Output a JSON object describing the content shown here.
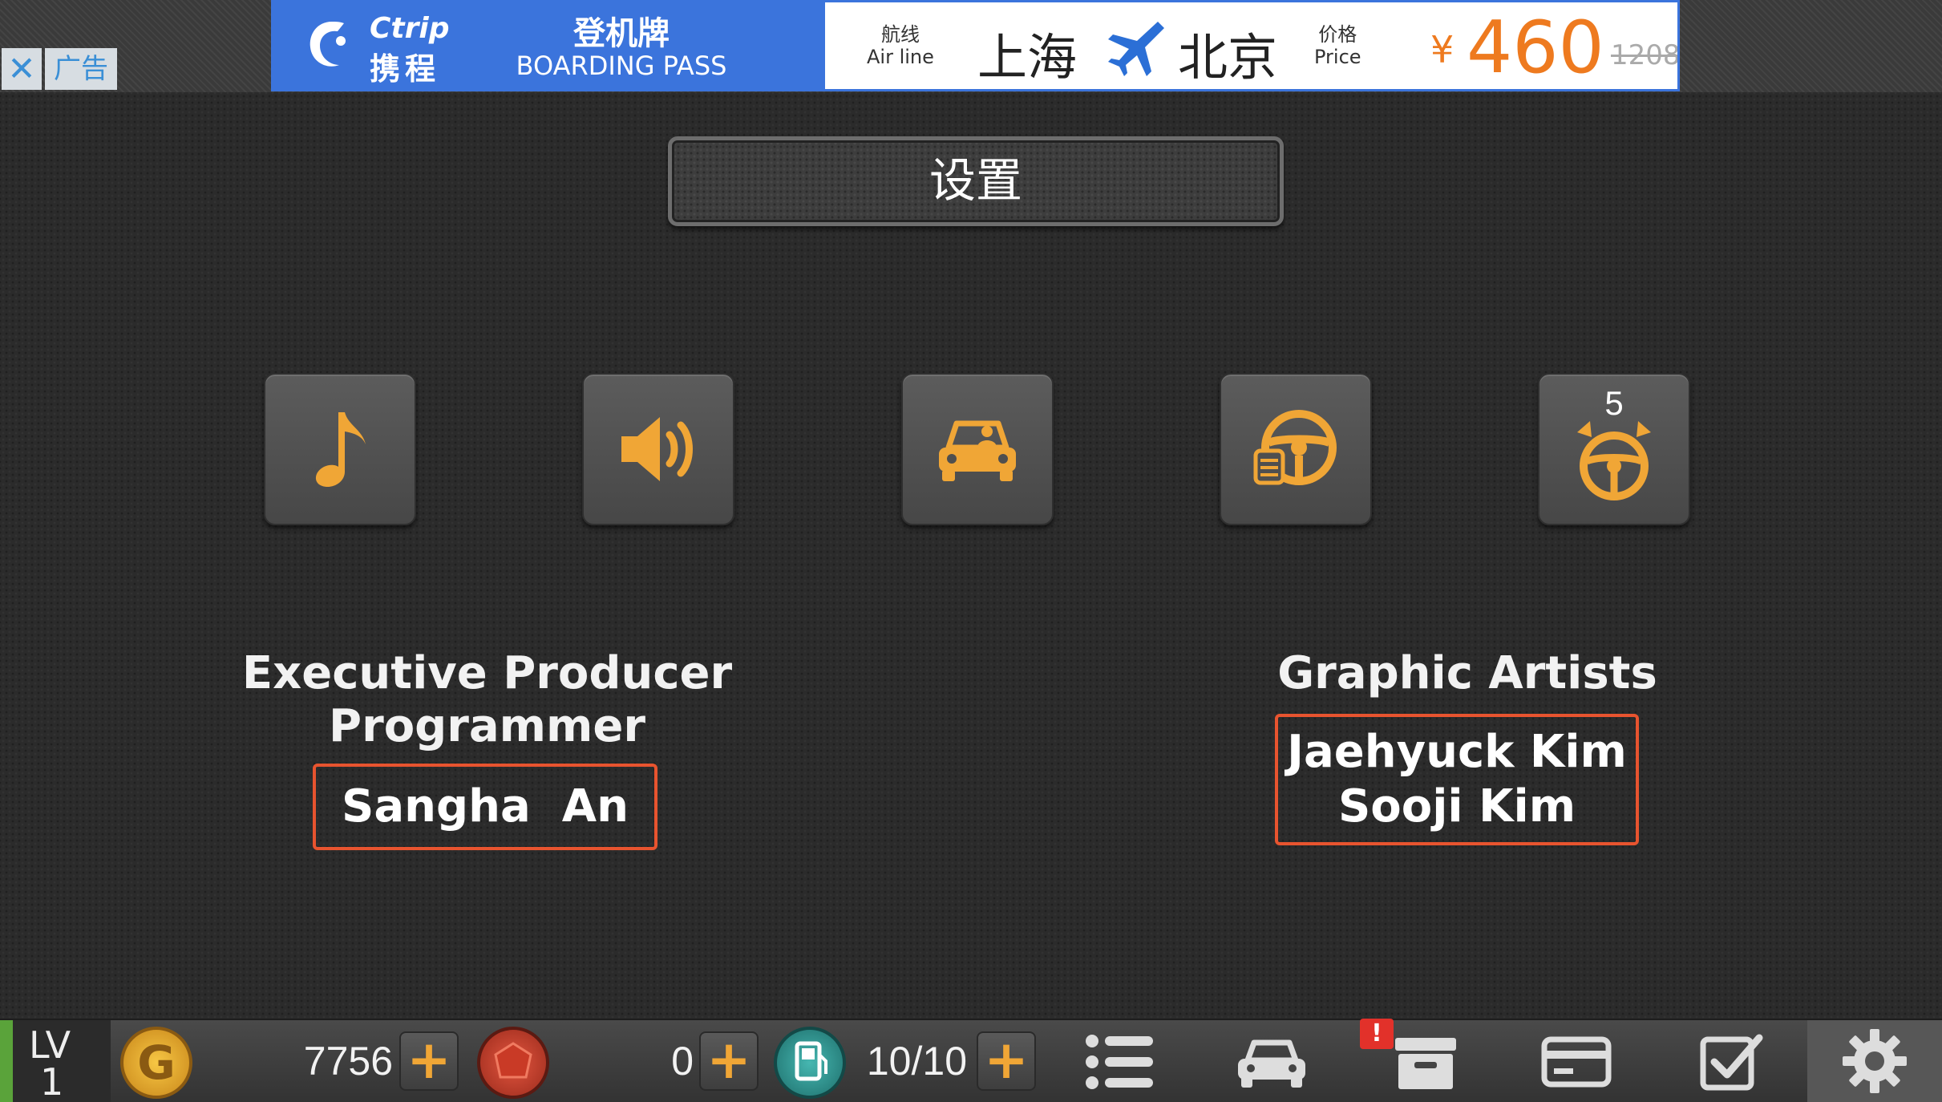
{
  "ad": {
    "close_glyph": "✕",
    "label": "广告",
    "brand_en": "Ctrip",
    "brand_cn": "携程",
    "boarding_cn": "登机牌",
    "boarding_en": "BOARDING PASS",
    "airline_cn": "航线",
    "airline_en": "Air line",
    "from_city": "上海",
    "to_city": "北京",
    "price_cn": "价格",
    "price_en": "Price",
    "currency": "¥",
    "price": "460",
    "old_price": "1208"
  },
  "title": "设置",
  "settings_buttons": [
    {
      "name": "music",
      "icon": "music-note-icon"
    },
    {
      "name": "sound",
      "icon": "speaker-icon"
    },
    {
      "name": "car-view",
      "icon": "car-driver-icon"
    },
    {
      "name": "steering-control",
      "icon": "steering-wheel-icon"
    },
    {
      "name": "steering-sensitivity",
      "icon": "steering-rotate-icon",
      "badge": "5"
    }
  ],
  "credits": {
    "left_role_1": "Executive Producer",
    "left_role_2": "Programmer",
    "left_name": "Sangha  An",
    "right_role": "Graphic Artists",
    "right_name_1": "Jaehyuck Kim",
    "right_name_2": "Sooji Kim"
  },
  "bottom_bar": {
    "level_label": "LV",
    "level_value": "1",
    "gold_glyph": "G",
    "gold": "7756",
    "gems": "0",
    "fuel": "10/10",
    "plus_glyph": "+",
    "alert_glyph": "!",
    "icons": [
      "list-icon",
      "car-icon",
      "archive-box-icon",
      "card-icon",
      "checkbox-icon",
      "gear-icon"
    ]
  },
  "colors": {
    "accent_orange": "#f0a636",
    "credit_border": "#e8542f",
    "ad_blue": "#3b74dc",
    "price_orange": "#ee7a1f",
    "level_green": "#5aa33a"
  }
}
